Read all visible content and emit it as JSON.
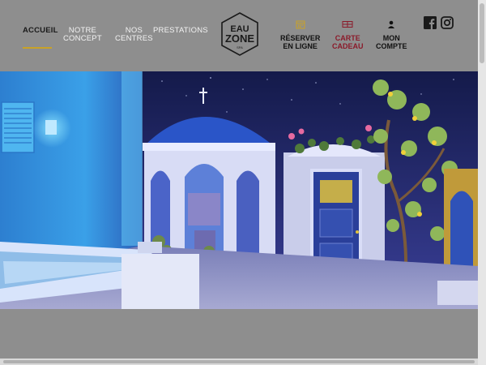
{
  "nav": {
    "items": [
      {
        "lines": [
          "ACCUEIL"
        ],
        "active": true
      },
      {
        "lines": [
          "NOTRE",
          "CONCEPT"
        ]
      },
      {
        "lines": [
          "NOS",
          "CENTRES"
        ]
      },
      {
        "lines": [
          "PRESTATIONS"
        ]
      }
    ]
  },
  "logo": {
    "line1": "EAU",
    "line2": "ZONE",
    "line3": "SPA"
  },
  "actions": {
    "book": {
      "line1": "RÉSERVER",
      "line2": "EN LIGNE",
      "icon": "calendar-icon"
    },
    "gift": {
      "line1": "CARTE",
      "line2": "CADEAU",
      "icon": "gift-card-icon"
    },
    "account": {
      "line1": "MON",
      "line2": "COMPTE",
      "icon": "user-icon"
    }
  },
  "social": [
    {
      "name": "facebook",
      "icon": "facebook-icon"
    },
    {
      "name": "instagram",
      "icon": "instagram-icon"
    }
  ],
  "colors": {
    "accent": "#c9a227",
    "gift": "#8b1a2a",
    "header_bg": "#8e8e8e"
  }
}
